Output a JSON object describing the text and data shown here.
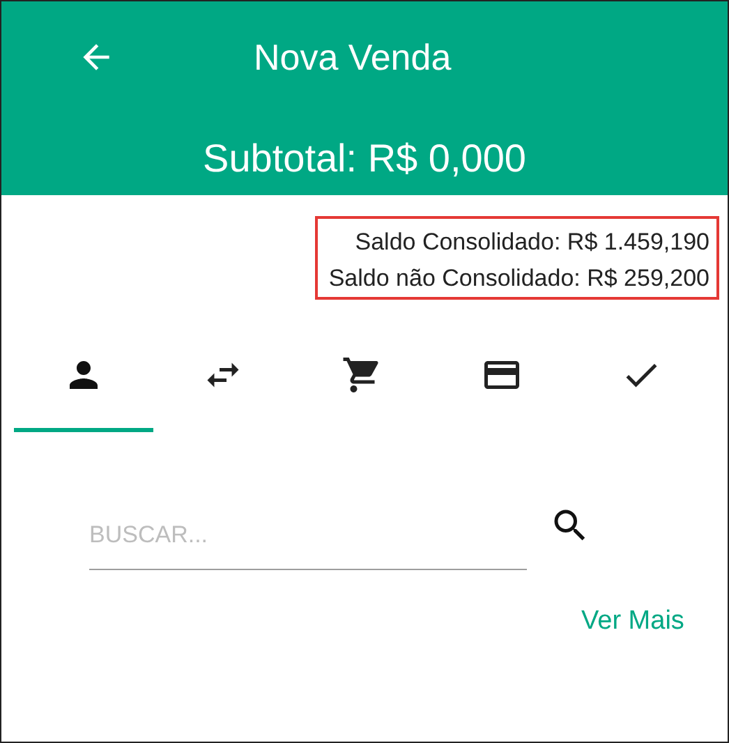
{
  "header": {
    "title": "Nova Venda",
    "subtotal": "Subtotal: R$ 0,000"
  },
  "balances": [
    "Saldo Consolidado: R$ 1.459,190",
    "Saldo não Consolidado: R$ 259,200"
  ],
  "tabs": [
    {
      "selected": true
    },
    {
      "selected": false
    },
    {
      "selected": false
    },
    {
      "selected": false
    },
    {
      "selected": false
    }
  ],
  "search": {
    "placeholder": "BUSCAR..."
  },
  "more_link": "Ver Mais"
}
